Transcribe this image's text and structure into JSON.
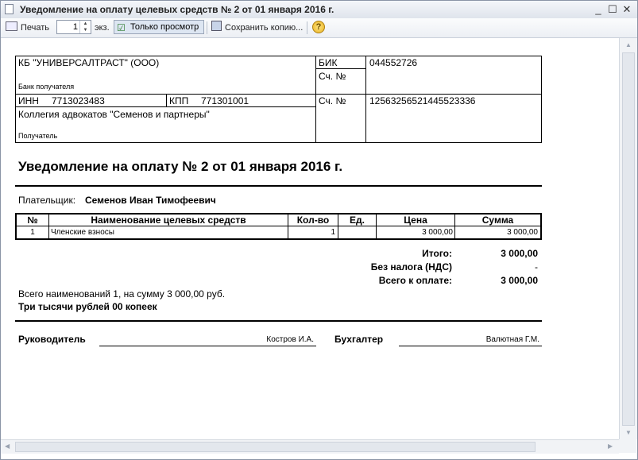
{
  "window": {
    "title": "Уведомление на оплату целевых средств № 2 от 01 января 2016 г."
  },
  "toolbar": {
    "print_label": "Печать",
    "copies_value": "1",
    "copies_suffix": "экз.",
    "view_only_label": "Только просмотр",
    "save_copy_label": "Сохранить копию...",
    "help_glyph": "?"
  },
  "bank": {
    "name": "КБ \"УНИВЕРСАЛТРАСТ\" (ООО)",
    "recipient_bank_caption": "Банк получателя",
    "bik_label": "БИК",
    "bik_value": "044552726",
    "account_label_1": "Сч. №",
    "account_label_2": "Сч. №",
    "account_value": "12563256521445523336",
    "inn_label": "ИНН",
    "inn_value": "7713023483",
    "kpp_label": "КПП",
    "kpp_value": "771301001",
    "recipient_name": "Коллегия адвокатов \"Семенов и партнеры\"",
    "recipient_caption": "Получатель"
  },
  "document": {
    "heading": "Уведомление на оплату № 2 от 01 января 2016 г.",
    "payer_label": "Плательщик:",
    "payer_name": "Семенов Иван Тимофеевич"
  },
  "table": {
    "headers": [
      "№",
      "Наименование целевых средств",
      "Кол-во",
      "Ед.",
      "Цена",
      "Сумма"
    ],
    "rows": [
      {
        "num": "1",
        "name": "Членские взносы",
        "qty": "1",
        "unit": "",
        "price": "3 000,00",
        "sum": "3 000,00"
      }
    ]
  },
  "totals": {
    "total_label": "Итого:",
    "total_value": "3 000,00",
    "vat_label": "Без налога (НДС)",
    "vat_value": "-",
    "due_label": "Всего к оплате:",
    "due_value": "3 000,00"
  },
  "summary": {
    "line1": "Всего наименований 1, на сумму 3 000,00 руб.",
    "line2": "Три тысячи рублей 00 копеек"
  },
  "signatures": {
    "head_label": "Руководитель",
    "head_name": "Костров И.А.",
    "accountant_label": "Бухгалтер",
    "accountant_name": "Валютная Г.М."
  }
}
